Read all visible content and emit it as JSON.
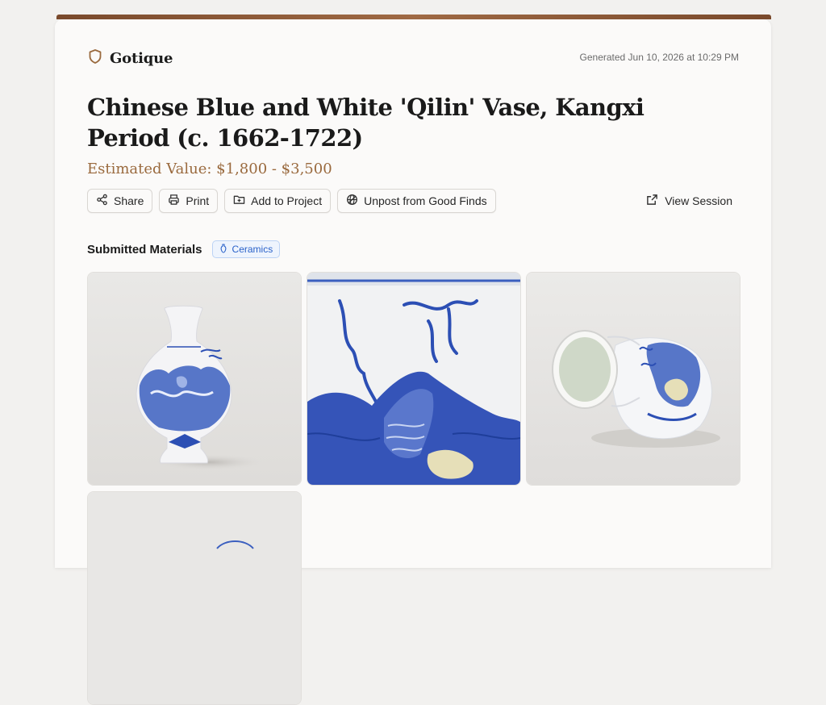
{
  "brand": {
    "name": "Gotique",
    "icon": "shield-icon"
  },
  "generated": "Generated Jun 10, 2026 at 10:29 PM",
  "item": {
    "title": "Chinese Blue and White 'Qilin' Vase, Kangxi Period (c. 1662-1722)",
    "estimate": "Estimated Value: $1,800 - $3,500"
  },
  "actions": [
    {
      "label": "Share",
      "icon": "share-icon"
    },
    {
      "label": "Print",
      "icon": "printer-icon"
    },
    {
      "label": "Add to Project",
      "icon": "folder-plus-icon"
    },
    {
      "label": "Unpost from Good Finds",
      "icon": "globe-icon"
    }
  ],
  "view_session": {
    "label": "View Session",
    "icon": "external-link-icon"
  },
  "materials": {
    "title": "Submitted Materials",
    "tag": {
      "label": "Ceramics",
      "icon": "vase-icon"
    },
    "images": [
      "vase-front-photo",
      "vase-detail-photo",
      "vase-tilted-photo",
      "vase-fourth-photo"
    ]
  },
  "colors": {
    "accent": "#9a6a3e",
    "tag_blue": "#2a62c9",
    "porcelain_blue": "#2c4fb4"
  }
}
